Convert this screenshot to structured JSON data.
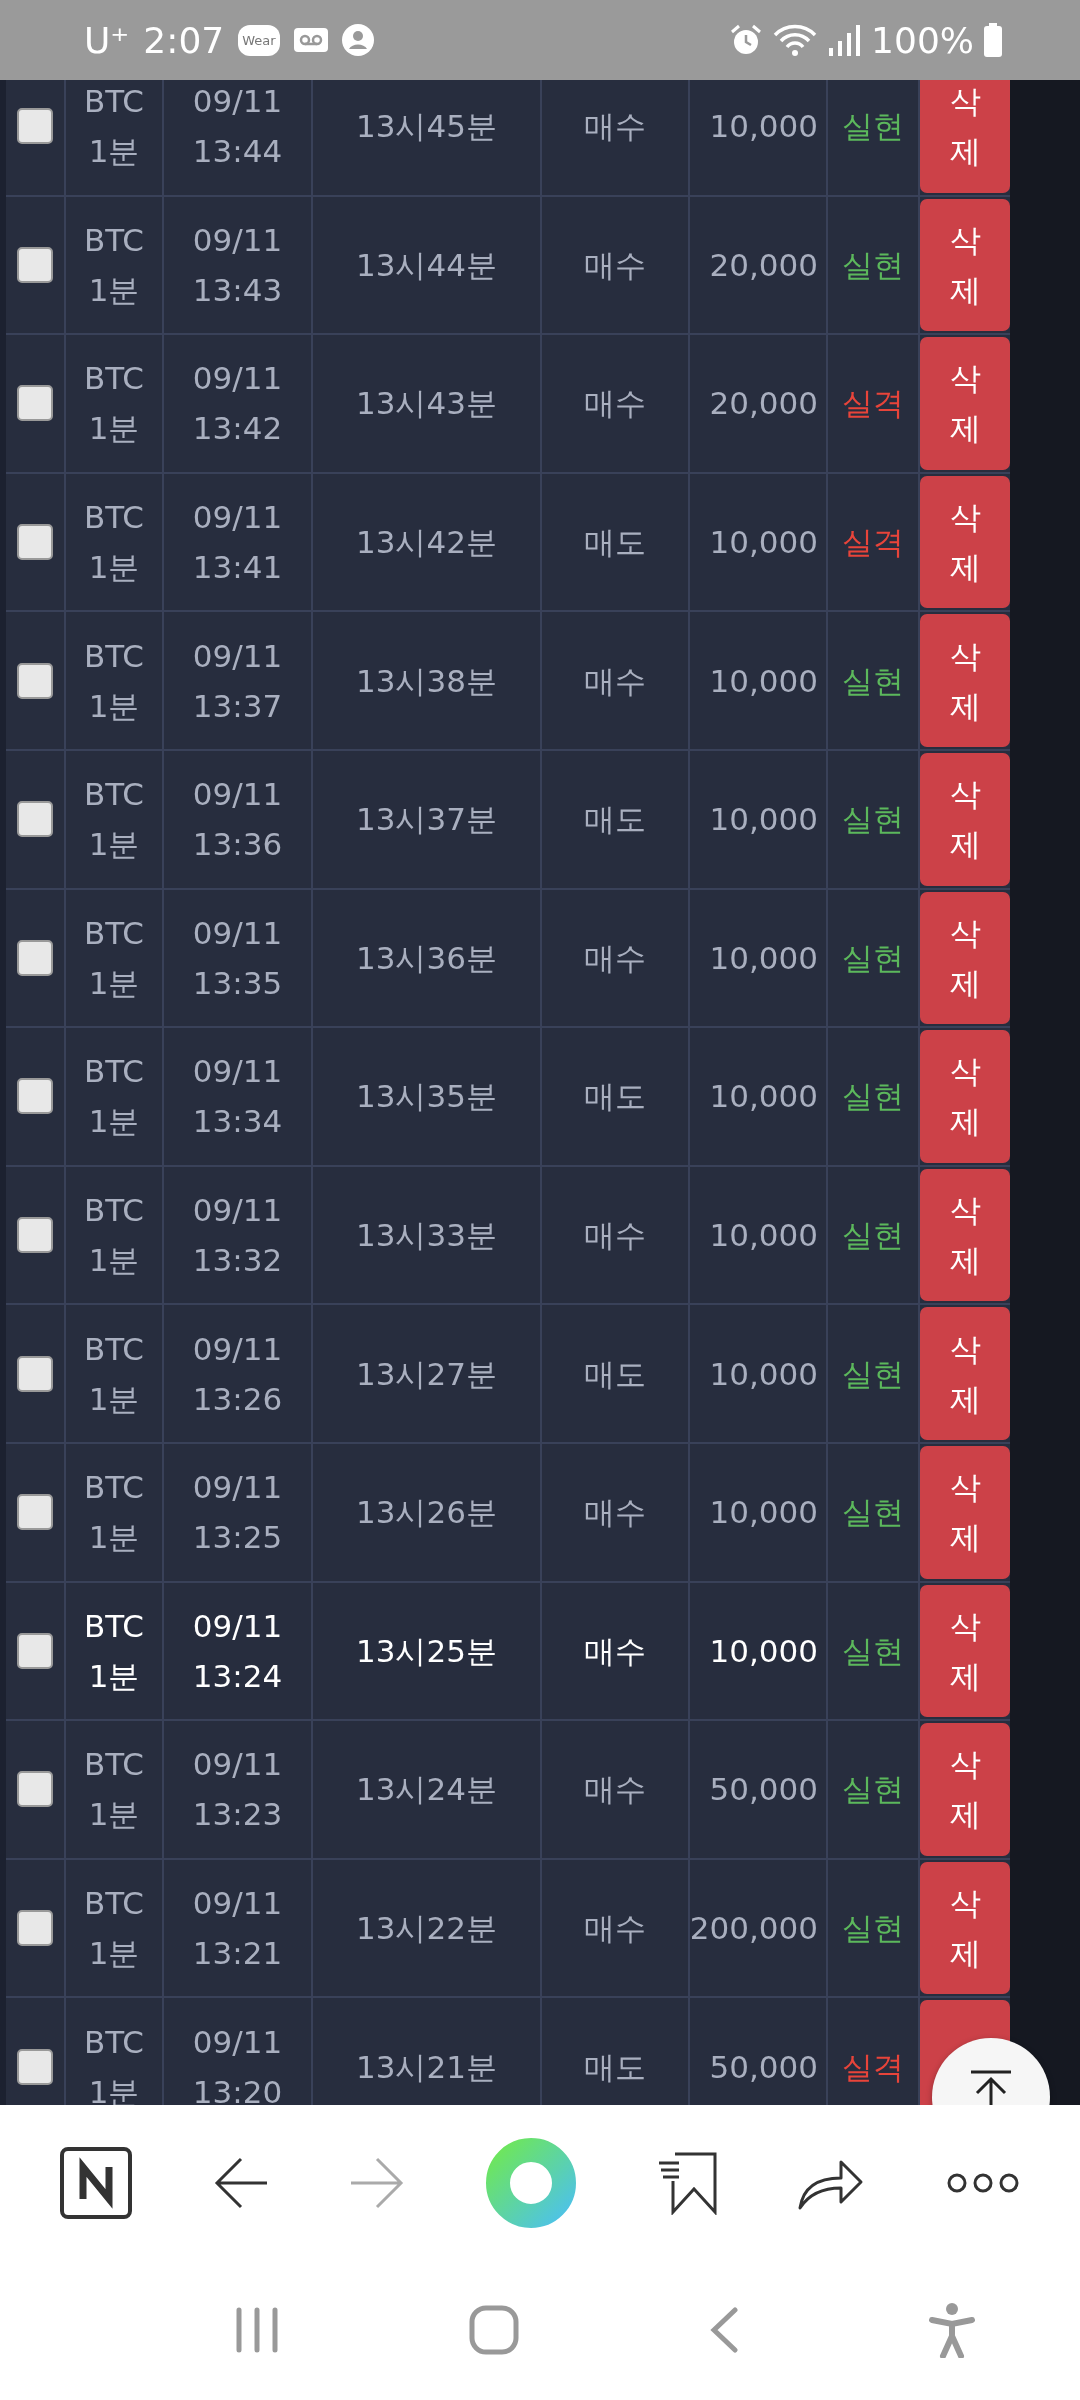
{
  "status_bar": {
    "carrier": "U⁺",
    "time": "2:07",
    "wear_badge": "Wear",
    "battery": "100%"
  },
  "rows": [
    {
      "checked": false,
      "symbol": "BTC",
      "interval": "1분",
      "date": "09/11",
      "time": "13:44",
      "round": "13시45분",
      "side": "매수",
      "amount": "10,000",
      "result": {
        "text": "실현",
        "color": "#5cb85c"
      },
      "highlighted": false,
      "action": "삭제"
    },
    {
      "checked": false,
      "symbol": "BTC",
      "interval": "1분",
      "date": "09/11",
      "time": "13:43",
      "round": "13시44분",
      "side": "매수",
      "amount": "20,000",
      "result": {
        "text": "실현",
        "color": "#5cb85c"
      },
      "highlighted": false,
      "action": "삭제"
    },
    {
      "checked": false,
      "symbol": "BTC",
      "interval": "1분",
      "date": "09/11",
      "time": "13:42",
      "round": "13시43분",
      "side": "매수",
      "amount": "20,000",
      "result": {
        "text": "실격",
        "color": "#e8443a"
      },
      "highlighted": false,
      "action": "삭제"
    },
    {
      "checked": false,
      "symbol": "BTC",
      "interval": "1분",
      "date": "09/11",
      "time": "13:41",
      "round": "13시42분",
      "side": "매도",
      "amount": "10,000",
      "result": {
        "text": "실격",
        "color": "#e8443a"
      },
      "highlighted": false,
      "action": "삭제"
    },
    {
      "checked": false,
      "symbol": "BTC",
      "interval": "1분",
      "date": "09/11",
      "time": "13:37",
      "round": "13시38분",
      "side": "매수",
      "amount": "10,000",
      "result": {
        "text": "실현",
        "color": "#5cb85c"
      },
      "highlighted": false,
      "action": "삭제"
    },
    {
      "checked": false,
      "symbol": "BTC",
      "interval": "1분",
      "date": "09/11",
      "time": "13:36",
      "round": "13시37분",
      "side": "매도",
      "amount": "10,000",
      "result": {
        "text": "실현",
        "color": "#5cb85c"
      },
      "highlighted": false,
      "action": "삭제"
    },
    {
      "checked": false,
      "symbol": "BTC",
      "interval": "1분",
      "date": "09/11",
      "time": "13:35",
      "round": "13시36분",
      "side": "매수",
      "amount": "10,000",
      "result": {
        "text": "실현",
        "color": "#5cb85c"
      },
      "highlighted": false,
      "action": "삭제"
    },
    {
      "checked": false,
      "symbol": "BTC",
      "interval": "1분",
      "date": "09/11",
      "time": "13:34",
      "round": "13시35분",
      "side": "매도",
      "amount": "10,000",
      "result": {
        "text": "실현",
        "color": "#5cb85c"
      },
      "highlighted": false,
      "action": "삭제"
    },
    {
      "checked": false,
      "symbol": "BTC",
      "interval": "1분",
      "date": "09/11",
      "time": "13:32",
      "round": "13시33분",
      "side": "매수",
      "amount": "10,000",
      "result": {
        "text": "실현",
        "color": "#5cb85c"
      },
      "highlighted": false,
      "action": "삭제"
    },
    {
      "checked": false,
      "symbol": "BTC",
      "interval": "1분",
      "date": "09/11",
      "time": "13:26",
      "round": "13시27분",
      "side": "매도",
      "amount": "10,000",
      "result": {
        "text": "실현",
        "color": "#5cb85c"
      },
      "highlighted": false,
      "action": "삭제"
    },
    {
      "checked": false,
      "symbol": "BTC",
      "interval": "1분",
      "date": "09/11",
      "time": "13:25",
      "round": "13시26분",
      "side": "매수",
      "amount": "10,000",
      "result": {
        "text": "실현",
        "color": "#5cb85c"
      },
      "highlighted": false,
      "action": "삭제"
    },
    {
      "checked": false,
      "symbol": "BTC",
      "interval": "1분",
      "date": "09/11",
      "time": "13:24",
      "round": "13시25분",
      "side": "매수",
      "amount": "10,000",
      "result": {
        "text": "실현",
        "color": "#5cb85c"
      },
      "highlighted": true,
      "action": "삭제"
    },
    {
      "checked": false,
      "symbol": "BTC",
      "interval": "1분",
      "date": "09/11",
      "time": "13:23",
      "round": "13시24분",
      "side": "매수",
      "amount": "50,000",
      "result": {
        "text": "실현",
        "color": "#5cb85c"
      },
      "highlighted": false,
      "action": "삭제"
    },
    {
      "checked": false,
      "symbol": "BTC",
      "interval": "1분",
      "date": "09/11",
      "time": "13:21",
      "round": "13시22분",
      "side": "매수",
      "amount": "200,000",
      "result": {
        "text": "실현",
        "color": "#5cb85c"
      },
      "highlighted": false,
      "action": "삭제"
    },
    {
      "checked": false,
      "symbol": "BTC",
      "interval": "1분",
      "date": "09/11",
      "time": "13:20",
      "round": "13시21분",
      "side": "매도",
      "amount": "50,000",
      "result": {
        "text": "실격",
        "color": "#e8443a"
      },
      "highlighted": false
    }
  ]
}
